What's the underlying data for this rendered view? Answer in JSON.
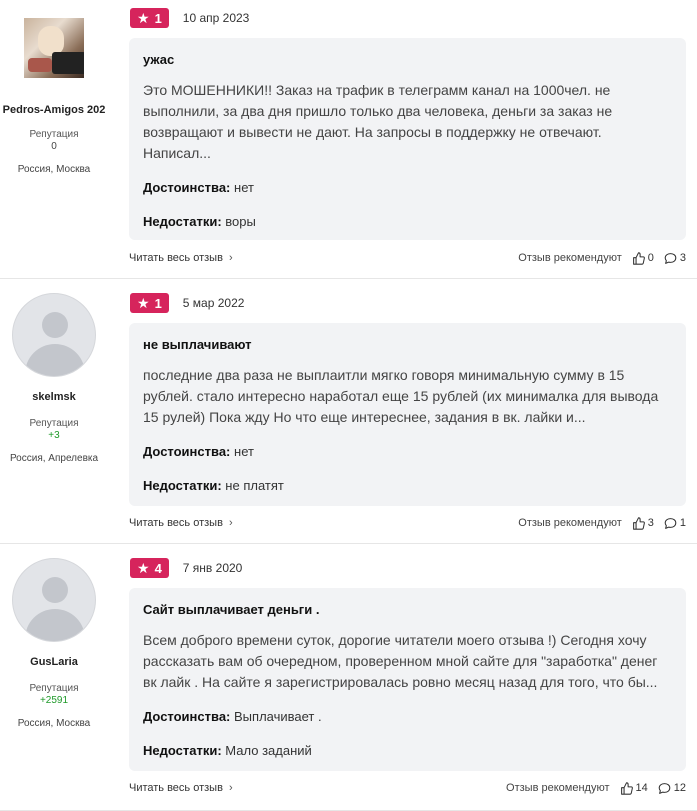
{
  "reviews": [
    {
      "author": {
        "name": "Pedros-Amigos 202",
        "rep_label": "Репутация",
        "rep_value": "0",
        "location": "Россия, Москва"
      },
      "rating": "1",
      "date": "10 апр 2023",
      "title": "ужас",
      "text": "Это МОШЕННИКИ!! Заказ на трафик в телеграмм канал на 1000чел. не выполнили, за два дня пришло только два человека, деньги за заказ не возвращают и вывести не дают. На запросы в поддержку не отвечают. Написал...",
      "pros_label": "Достоинства:",
      "pros": "нет",
      "cons_label": "Недостатки:",
      "cons": "воры",
      "read_more": "Читать весь отзыв",
      "recommend_label": "Отзыв рекомендуют",
      "likes": "0",
      "comments": "3"
    },
    {
      "author": {
        "name": "skelmsk",
        "rep_label": "Репутация",
        "rep_value": "+3",
        "location": "Россия, Апрелевка"
      },
      "rating": "1",
      "date": "5 мар 2022",
      "title": "не выплачивают",
      "text": "последние два раза не выплаитли мягко говоря минимальную сумму в 15 рублей. стало интересно наработал еще 15 рублей (их минималка для вывода 15 рулей) Пока жду Но что еще интереснее, задания в вк. лайки и...",
      "pros_label": "Достоинства:",
      "pros": "нет",
      "cons_label": "Недостатки:",
      "cons": "не платят",
      "read_more": "Читать весь отзыв",
      "recommend_label": "Отзыв рекомендуют",
      "likes": "3",
      "comments": "1"
    },
    {
      "author": {
        "name": "GusLaria",
        "rep_label": "Репутация",
        "rep_value": "+2591",
        "location": "Россия, Москва"
      },
      "rating": "4",
      "date": "7 янв 2020",
      "title": "Сайт выплачивает деньги .",
      "text": "Всем доброго времени суток, дорогие читатели моего отзыва !) Сегодня хочу рассказать вам об очередном, проверенном мной сайте для \"заработка\" денег вк лайк . На сайте я зарегистрировалась ровно месяц назад для того, что бы...",
      "pros_label": "Достоинства:",
      "pros": "Выплачивает .",
      "cons_label": "Недостатки:",
      "cons": "Мало заданий",
      "read_more": "Читать весь отзыв",
      "recommend_label": "Отзыв рекомендуют",
      "likes": "14",
      "comments": "12"
    }
  ],
  "colors": {
    "rating_badge": "#d6245c",
    "card_bg": "#f2f3f5",
    "positive_rep": "#1f9a2a"
  },
  "icons": {
    "star": "star-icon",
    "like": "thumbs-up-icon",
    "comment": "comment-icon",
    "chevron": "chevron-right-icon"
  }
}
